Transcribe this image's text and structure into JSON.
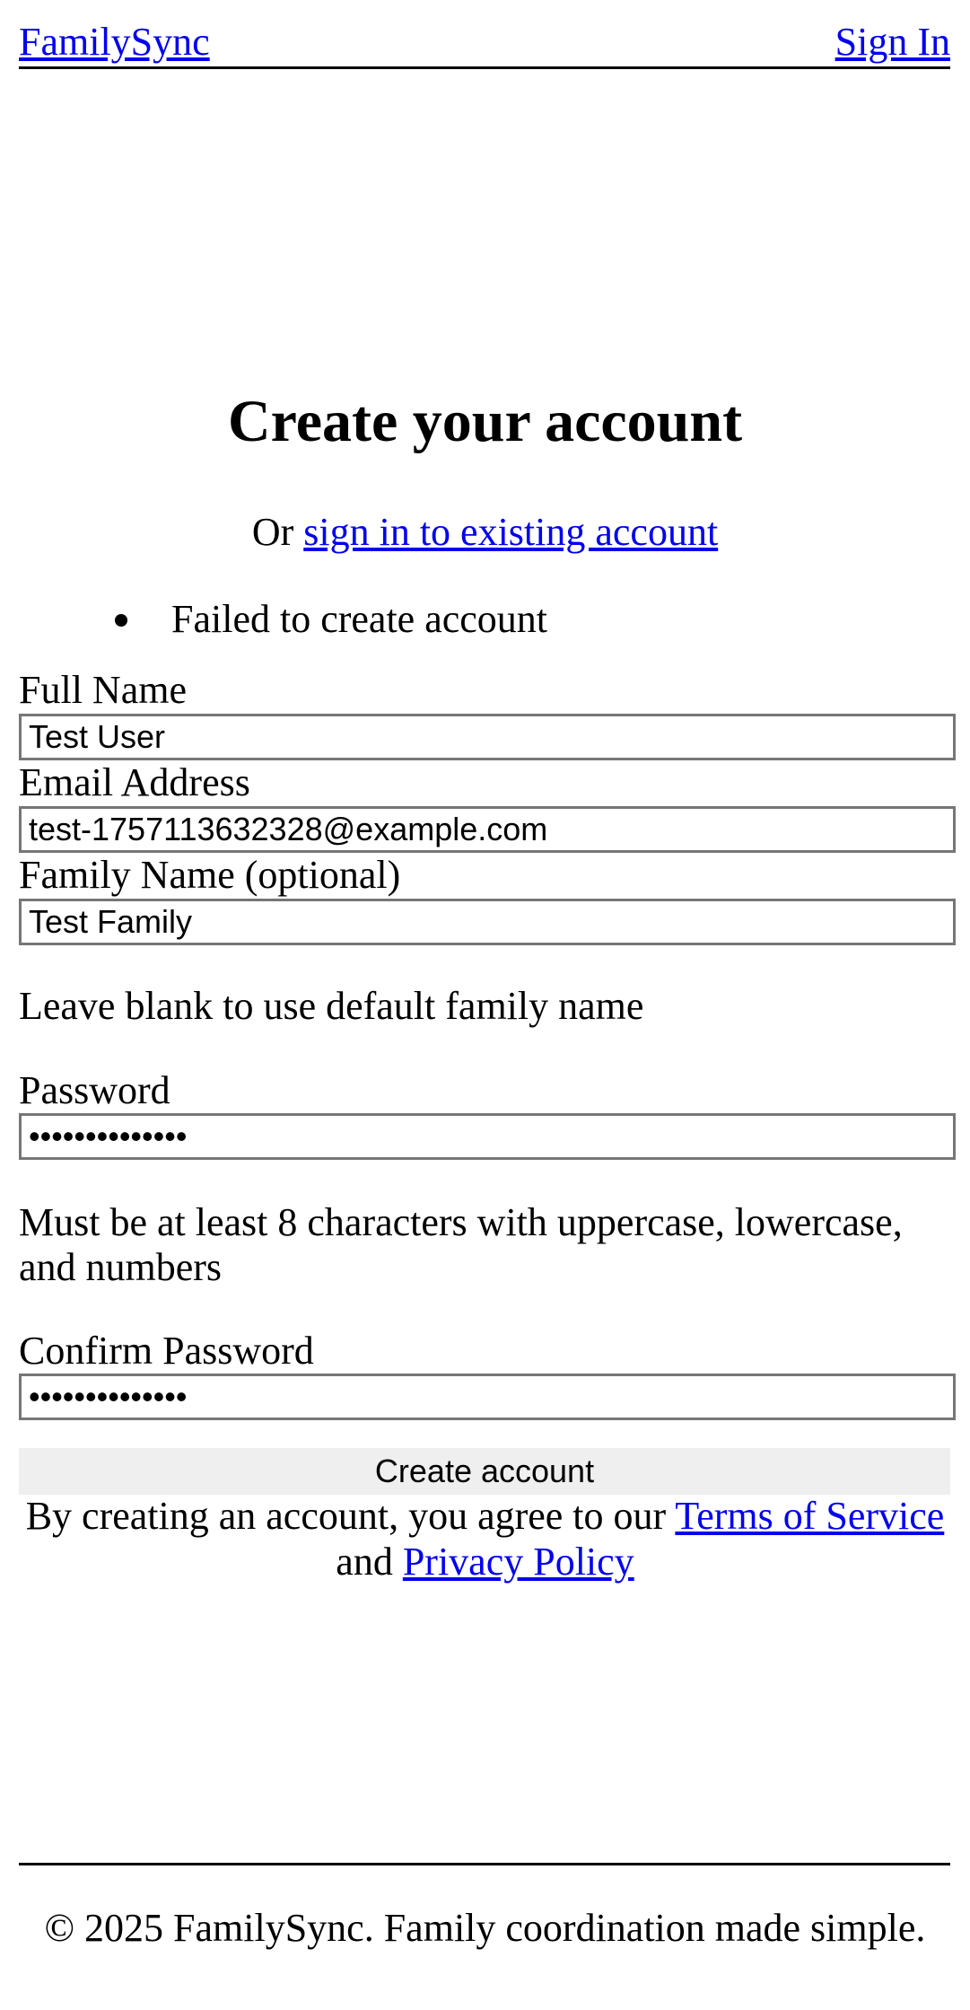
{
  "header": {
    "brand": "FamilySync",
    "sign_in": "Sign In"
  },
  "page": {
    "title": "Create your account",
    "subtitle_prefix": "Or ",
    "subtitle_link": "sign in to existing account"
  },
  "errors": [
    "Failed to create account"
  ],
  "form": {
    "full_name_label": "Full Name",
    "full_name_value": "Test User",
    "email_label": "Email Address",
    "email_value": "test-1757113632328@example.com",
    "family_label": "Family Name (optional)",
    "family_value": "Test Family",
    "family_help": "Leave blank to use default family name",
    "password_label": "Password",
    "password_value": "••••••••••••••",
    "password_help": "Must be at least 8 characters with uppercase, lowercase, and numbers",
    "confirm_label": "Confirm Password",
    "confirm_value": "••••••••••••••",
    "submit_label": "Create account"
  },
  "terms": {
    "prefix": "By creating an account, you agree to our ",
    "tos_link": "Terms of Service",
    "middle": " and ",
    "privacy_link": "Privacy Policy"
  },
  "footer": {
    "text": "© 2025 FamilySync. Family coordination made simple."
  },
  "colors": {
    "link": "#0000ee",
    "button_bg": "#efefef",
    "input_border": "#767676"
  }
}
